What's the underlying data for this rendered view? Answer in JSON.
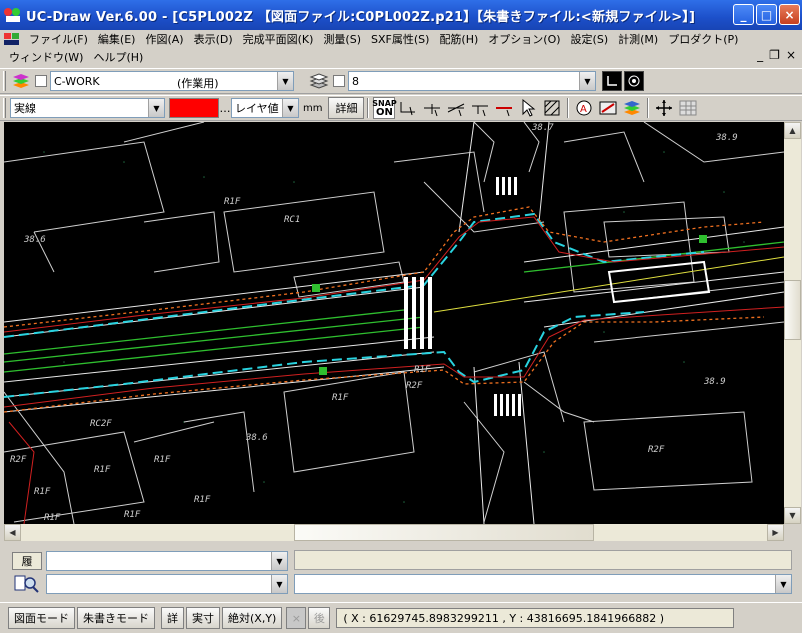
{
  "window": {
    "title": "UC-Draw Ver.6.00 - [C5PL002Z 【図面ファイル:C0PL002Z.p21】【朱書きファイル:<新規ファイル>】]",
    "controls": {
      "minimize": "_",
      "maximize": "□",
      "close": "×"
    }
  },
  "menu": {
    "items": [
      "ファイル(F)",
      "編集(E)",
      "作図(A)",
      "表示(D)",
      "完成平面図(K)",
      "測量(S)",
      "SXF属性(S)",
      "配筋(H)",
      "オプション(O)",
      "設定(S)",
      "計測(M)",
      "プロダクト(P)"
    ],
    "items2": [
      "ウィンドウ(W)",
      "ヘルプ(H)"
    ],
    "mdi": {
      "minimize": "_",
      "restore": "❐",
      "close": "×"
    }
  },
  "toolbar1": {
    "layer_combo": {
      "name": "C-WORK",
      "desc": "(作業用)"
    },
    "color_combo": "8"
  },
  "toolbar2": {
    "line_type": "実線",
    "ellipsis": "…",
    "width_mode": "レイヤ値",
    "unit": "mm",
    "detail_button": "詳細",
    "snap": {
      "line1": "SNAP",
      "line2": "ON"
    },
    "colors": {
      "line_color": "#ff0000"
    }
  },
  "canvas": {
    "background": "#000000",
    "labels": [
      {
        "text": "R1F"
      },
      {
        "text": "RC1"
      },
      {
        "text": "38.6"
      },
      {
        "text": "38.7"
      },
      {
        "text": "38.9"
      },
      {
        "text": "R1F"
      },
      {
        "text": "R2F"
      },
      {
        "text": "R1F"
      },
      {
        "text": "RC2F"
      },
      {
        "text": "R1F"
      },
      {
        "text": "R1F"
      },
      {
        "text": "R1F"
      },
      {
        "text": "38.6"
      },
      {
        "text": "R2F"
      },
      {
        "text": "38.9"
      },
      {
        "text": "R1F"
      },
      {
        "text": "R2F"
      },
      {
        "text": "R1F"
      },
      {
        "text": "R1F"
      }
    ]
  },
  "bottom": {
    "history_label": "履",
    "history_value": "",
    "command_value": ""
  },
  "status": {
    "buttons": [
      "図面モード",
      "朱書きモード",
      "詳",
      "実寸",
      "絶対(X,Y)"
    ],
    "disabled": [
      "×",
      "後"
    ],
    "coordinates": "( X : 61629745.8983299211 , Y : 43816695.1841966882 )"
  }
}
